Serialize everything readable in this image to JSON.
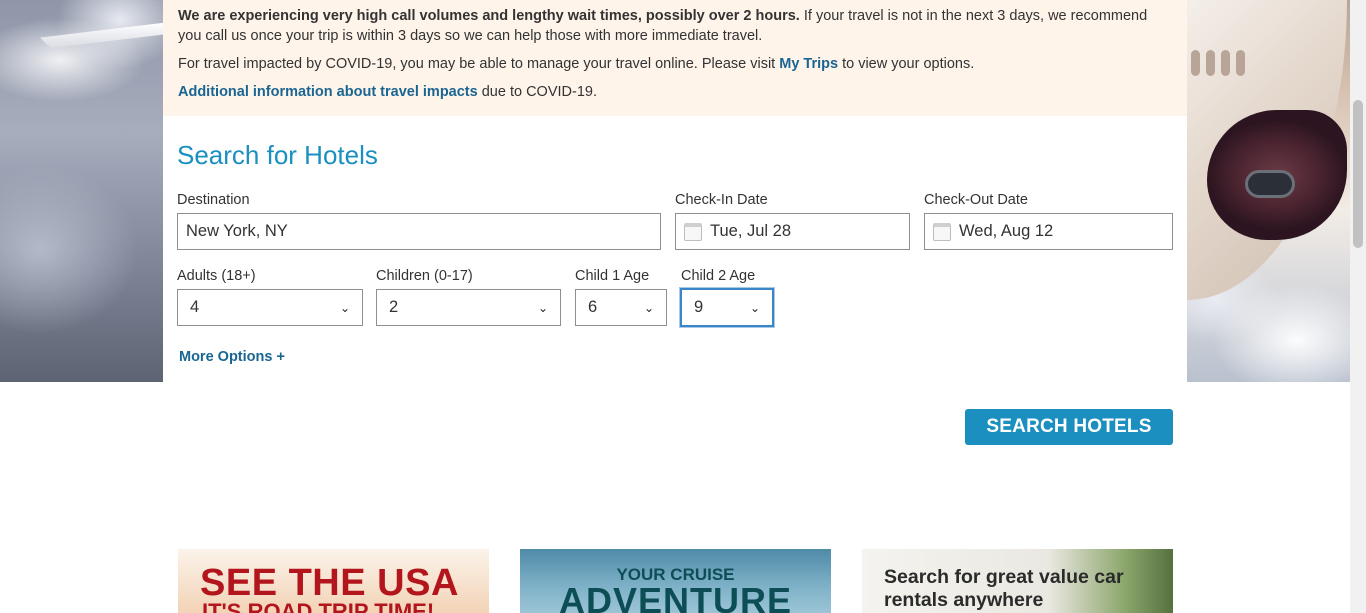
{
  "alert": {
    "line1_bold": "We are experiencing very high call volumes and lengthy wait times, possibly over 2 hours.",
    "line1_rest": " If your travel is not in the next 3 days, we recommend you call us once your trip is within 3 days so we can help those with more immediate travel.",
    "line2_pre": "For travel impacted by COVID-19, you may be able to manage your travel online. Please visit ",
    "line2_link": "My Trips",
    "line2_post": " to view your options.",
    "line3_link": "Additional information about travel impacts",
    "line3_post": " due to COVID-19."
  },
  "search": {
    "title": "Search for Hotels",
    "destination_label": "Destination",
    "destination_value": "New York, NY",
    "checkin_label": "Check-In Date",
    "checkin_value": "Tue, Jul 28",
    "checkout_label": "Check-Out Date",
    "checkout_value": "Wed, Aug 12",
    "adults_label": "Adults (18+)",
    "adults_value": "4",
    "children_label": "Children (0-17)",
    "children_value": "2",
    "child1_label": "Child 1 Age",
    "child1_value": "6",
    "child2_label": "Child 2 Age",
    "child2_value": "9",
    "more_options": "More Options +",
    "search_button": "SEARCH HOTELS"
  },
  "promos": {
    "usa_line1": "SEE THE USA",
    "usa_line2": "IT'S ROAD TRIP TIME!",
    "cruise_line1": "YOUR CRUISE",
    "cruise_line2": "ADVENTURE",
    "car_text": "Search for great value car rentals anywhere"
  },
  "colors": {
    "accent": "#1b8fc0",
    "link": "#1a6592",
    "alert_bg": "#fef4ea"
  }
}
